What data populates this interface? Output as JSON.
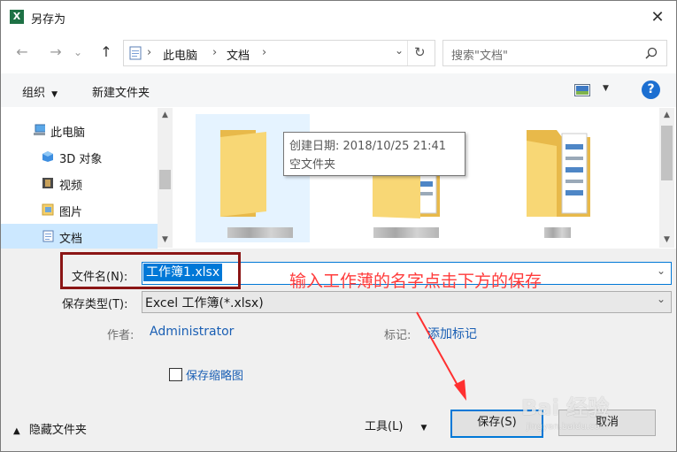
{
  "window": {
    "title": "另存为",
    "app_icon": "excel-icon",
    "close_glyph": "✕"
  },
  "nav": {
    "back_glyph": "←",
    "forward_glyph": "→",
    "recent_glyph": "⌄",
    "up_glyph": "↑",
    "breadcrumb": [
      "此电脑",
      "文档"
    ],
    "refresh_glyph": "↻",
    "search_placeholder": "搜索\"文档\""
  },
  "toolbar": {
    "organize_label": "组织",
    "new_folder_label": "新建文件夹",
    "help_label": "?"
  },
  "sidebar": {
    "items": [
      {
        "label": "此电脑",
        "icon": "computer-icon"
      },
      {
        "label": "3D 对象",
        "icon": "3d-objects-icon"
      },
      {
        "label": "视频",
        "icon": "video-icon"
      },
      {
        "label": "图片",
        "icon": "pictures-icon"
      },
      {
        "label": "文档",
        "icon": "documents-icon",
        "selected": true
      }
    ]
  },
  "tooltip": {
    "line1": "创建日期: 2018/10/25 21:41",
    "line2": "空文件夹"
  },
  "form": {
    "filename_label": "文件名(N):",
    "filename_value": "工作簿1.xlsx",
    "filetype_label": "保存类型(T):",
    "filetype_value": "Excel 工作簿(*.xlsx)",
    "author_label": "作者:",
    "author_value": "Administrator",
    "tags_label": "标记:",
    "tags_value": "添加标记",
    "thumbnail_label": "保存缩略图"
  },
  "annotation": {
    "text": "输入工作薄的名字点击下方的保存",
    "color": "#ff3b3b"
  },
  "footer": {
    "hide_folders_label": "隐藏文件夹",
    "tools_label": "工具(L)",
    "save_label": "保存(S)",
    "cancel_label": "取消"
  },
  "watermark": {
    "text": "Bai 经验",
    "subtext": "jingyan.baidu.com"
  },
  "colors": {
    "accent": "#0078d7",
    "folder": "#f5cf6a",
    "selection": "#cce8ff",
    "annotation_box": "#8b1515"
  }
}
